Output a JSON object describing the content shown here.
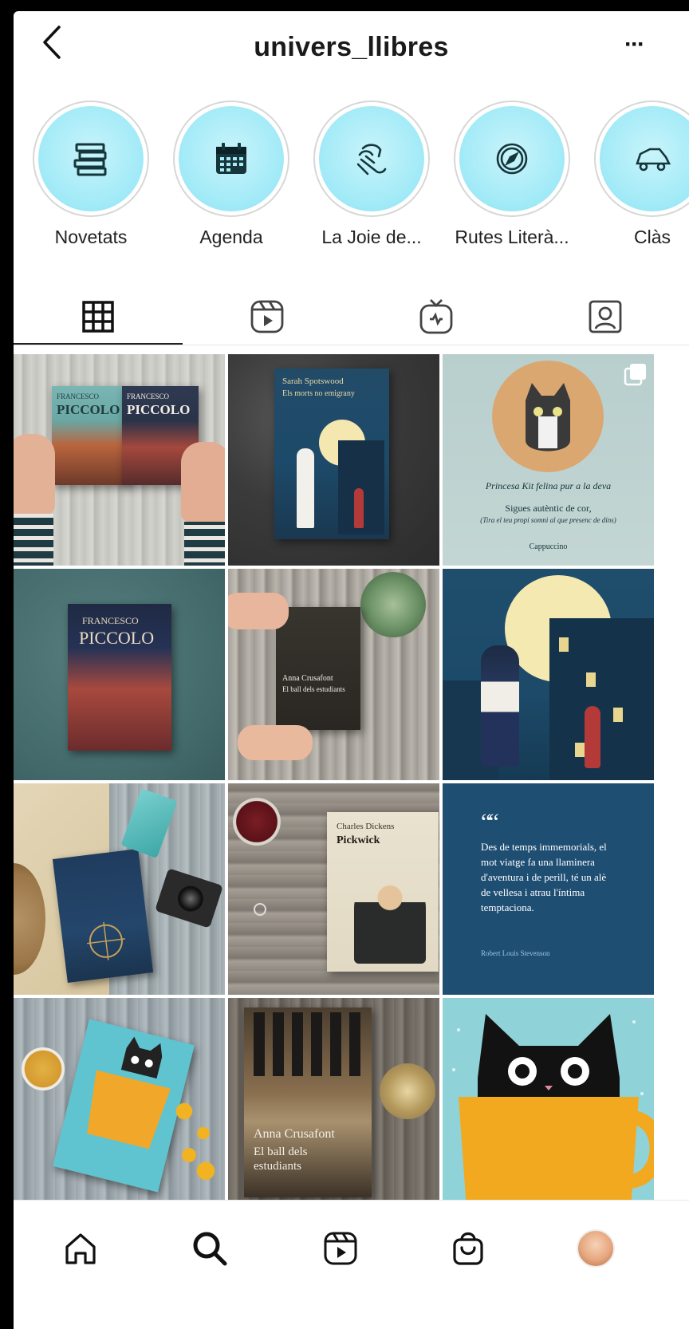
{
  "header": {
    "title": "univers_llibres",
    "back_icon": "chevron-left-icon",
    "more_label": "···"
  },
  "highlights": [
    {
      "label": "Novetats",
      "icon": "books-stack-icon"
    },
    {
      "label": "Agenda",
      "icon": "calendar-icon"
    },
    {
      "label": "La Joie de...",
      "icon": "hand-icon"
    },
    {
      "label": "Rutes Literà...",
      "icon": "compass-icon"
    },
    {
      "label": "Clàs",
      "icon": "car-icon"
    }
  ],
  "tabs": [
    {
      "name": "grid",
      "icon": "grid-icon",
      "active": true
    },
    {
      "name": "reels",
      "icon": "reels-icon",
      "active": false
    },
    {
      "name": "igtv",
      "icon": "igtv-icon",
      "active": false
    },
    {
      "name": "tagged",
      "icon": "tagged-user-icon",
      "active": false
    }
  ],
  "posts": {
    "p1": {
      "cover_a": "FRANCESCO",
      "cover_b": "PICCOLO",
      "cover_c": "FRANCESCO",
      "cover_d": "PICCOLO"
    },
    "p2": {
      "author": "Sarah Spotswood",
      "title": "Els morts no emigrany"
    },
    "p3": {
      "line1": "Princesa Kit felina pur a la deva",
      "line2": "Sigues autèntic de cor,",
      "line3": "(Tira el teu propi somni al que presenc de dins)",
      "line4": "Cappuccino"
    },
    "p4": {
      "author": "FRANCESCO",
      "title": "PICCOLO"
    },
    "p5": {
      "author": "Anna Crusafont",
      "title": "El ball dels estudiants"
    },
    "p8": {
      "author": "Charles Dickens",
      "title": "Pickwick"
    },
    "p9": {
      "quote_mark": "““",
      "text": "Des de temps immemorials, el mot viatge fa una llaminera d'aventura i de perill, té un alè de vellesa i atrau l'íntima temptaciona.",
      "source": "Robert Louis Stevenson"
    },
    "p11": {
      "author": "Anna Crusafont",
      "title": "El ball dels estudiants"
    }
  },
  "bottom_nav": [
    {
      "name": "home",
      "icon": "home-icon"
    },
    {
      "name": "search",
      "icon": "search-icon"
    },
    {
      "name": "reels",
      "icon": "reels-icon"
    },
    {
      "name": "shop",
      "icon": "shopping-bag-icon"
    },
    {
      "name": "profile",
      "icon": "avatar"
    }
  ],
  "colors": {
    "highlight_fill": "#a8ecf8",
    "text_primary": "#1a1a1a",
    "divider": "#e5e5e5"
  }
}
